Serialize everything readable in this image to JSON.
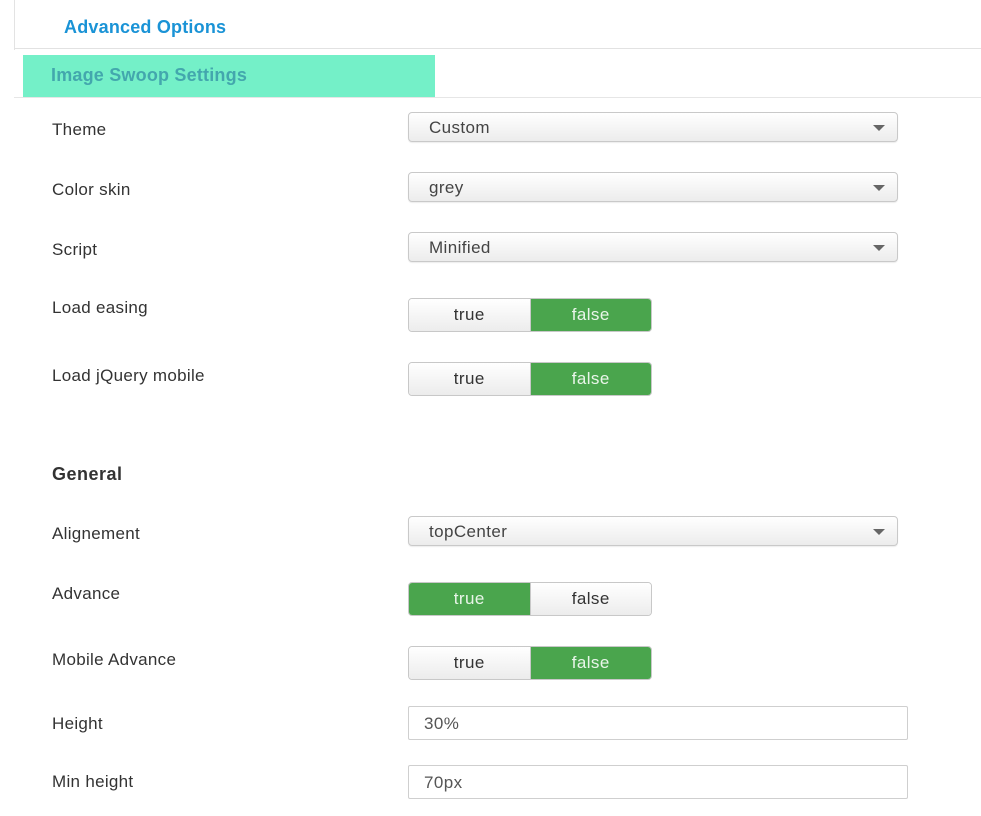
{
  "header": {
    "title": "Advanced Options"
  },
  "tab": {
    "label": "Image Swoop Settings"
  },
  "settings": {
    "theme": {
      "label": "Theme",
      "value": "Custom"
    },
    "color_skin": {
      "label": "Color skin",
      "value": "grey"
    },
    "script": {
      "label": "Script",
      "value": "Minified"
    },
    "load_easing": {
      "label": "Load easing",
      "true_label": "true",
      "false_label": "false",
      "selected": "false"
    },
    "load_jquery_mobile": {
      "label": "Load jQuery mobile",
      "true_label": "true",
      "false_label": "false",
      "selected": "false"
    }
  },
  "general": {
    "heading": "General",
    "alignement": {
      "label": "Alignement",
      "value": "topCenter"
    },
    "advance": {
      "label": "Advance",
      "true_label": "true",
      "false_label": "false",
      "selected": "true"
    },
    "mobile_advance": {
      "label": "Mobile Advance",
      "true_label": "true",
      "false_label": "false",
      "selected": "false"
    },
    "height": {
      "label": "Height",
      "value": "30%"
    },
    "min_height": {
      "label": "Min height",
      "value": "70px"
    }
  },
  "colors": {
    "accent_green": "#4aa54d",
    "tab_bg": "#74f0c8",
    "header_blue": "#1a93d6"
  },
  "icons": {
    "dropdown": "chevron-down-icon"
  }
}
